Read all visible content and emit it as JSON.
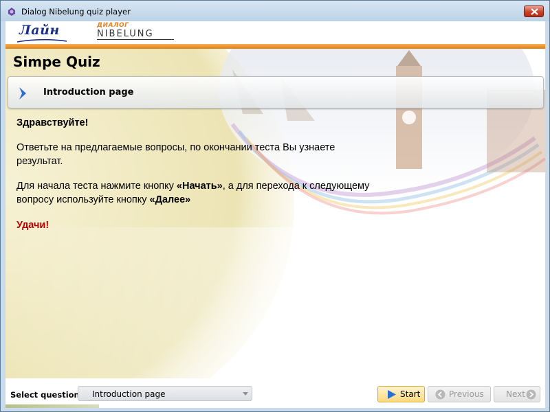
{
  "window": {
    "title": "Dialog Nibelung quiz player",
    "close_icon": "close-icon"
  },
  "header": {
    "logo_left": "Лайн",
    "logo_right_top": "ДИАЛОГ",
    "logo_right_bottom": "NIBELUNG",
    "accent_color": "#e88c1a"
  },
  "quiz": {
    "title": "Simpe Quiz",
    "page_label": "Introduction page",
    "page_icon": "chevron-right-icon"
  },
  "body": {
    "greeting": "Здравствуйте!",
    "para1": "Ответьте на предлагаемые вопросы, по окончании теста Вы узнаете результат.",
    "para2_a": "Для начала теста нажмите кнопку ",
    "para2_b": "«Начать»",
    "para2_c": ", а для перехода к следующему вопросу используйте кнопку ",
    "para2_d": "«Далее»",
    "luck": "Удачи!",
    "luck_color": "#b40000"
  },
  "footer": {
    "select_label": "Select question:",
    "select_value": "Introduction page",
    "start_label": "Start",
    "previous_label": "Previous",
    "next_label": "Next"
  }
}
